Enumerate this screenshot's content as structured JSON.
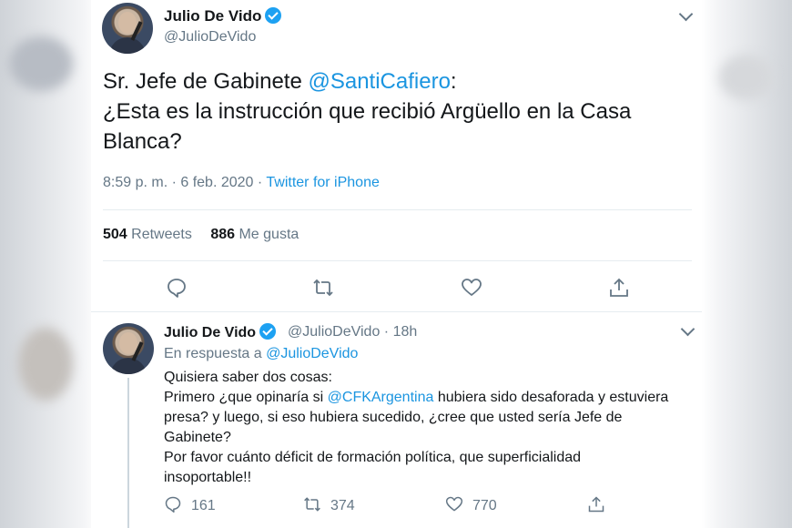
{
  "main_tweet": {
    "author_name": "Julio De Vido",
    "author_handle": "@JulioDeVido",
    "text_prefix": "Sr. Jefe de Gabinete ",
    "mention": "@SantiCafiero",
    "text_suffix": ":",
    "line2": "¿Esta es la instrucción que recibió Argüello en la Casa",
    "line3": "Blanca?",
    "time": "8:59 p. m. · 6 feb. 2020 · ",
    "source": "Twitter for iPhone",
    "retweets_count": "504",
    "retweets_label": "Retweets",
    "likes_count": "886",
    "likes_label": "Me gusta",
    "actions": [
      "reply-icon",
      "retweet-icon",
      "like-icon",
      "share-icon"
    ]
  },
  "reply_tweet": {
    "author_name": "Julio De Vido",
    "author_handle": "@JulioDeVido",
    "time_sep": "·",
    "time": "18h",
    "in_reply_prefix": "En respuesta a ",
    "in_reply_handle": "@JulioDeVido",
    "line1": "Quisiera saber dos cosas:",
    "line2_prefix": "Primero ¿que opinaría si ",
    "line2_mention": "@CFKArgentina",
    "line2_suffix": " hubiera sido desaforada y estuviera",
    "line3": "presa? y luego, si eso hubiera sucedido, ¿cree que usted sería Jefe de",
    "line4": "Gabinete?",
    "line5": "Por favor cuánto déficit de formación política, que superficialidad",
    "line6": "insoportable!!",
    "reply_count": "161",
    "retweet_count": "374",
    "like_count": "770"
  },
  "colors": {
    "link": "#1b95e0",
    "text": "#14171a",
    "muted": "#657786",
    "verified": "#1da1f2"
  }
}
